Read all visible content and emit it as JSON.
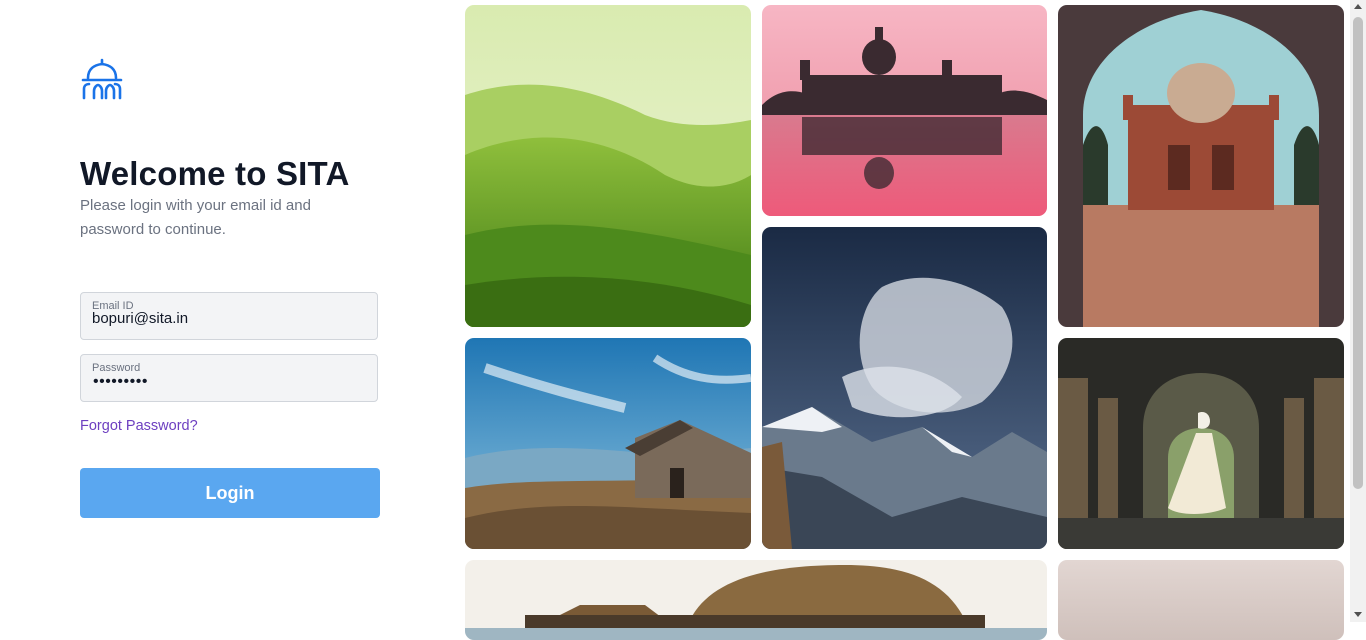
{
  "brand": {
    "logo_icon": "palace-dome-icon",
    "accent_color": "#1a73e8"
  },
  "login": {
    "title": "Welcome to SITA",
    "subtitle": "Please login with your email id and password to continue.",
    "email": {
      "label": "Email ID",
      "value": "bopuri@sita.in"
    },
    "password": {
      "label": "Password",
      "masked_value": "•••••••••"
    },
    "forgot_link": "Forgot Password?",
    "login_button": "Login",
    "button_color": "#5aa7f0",
    "link_color": "#6d3fc0"
  },
  "gallery": {
    "images": [
      "tea-plantation-hills-image",
      "victoria-memorial-reflection-image",
      "safdarjung-tomb-arch-image",
      "mountain-hut-image",
      "snow-mountain-clouds-image",
      "dancer-corridor-image",
      "houseboat-image",
      "misty-image"
    ]
  }
}
